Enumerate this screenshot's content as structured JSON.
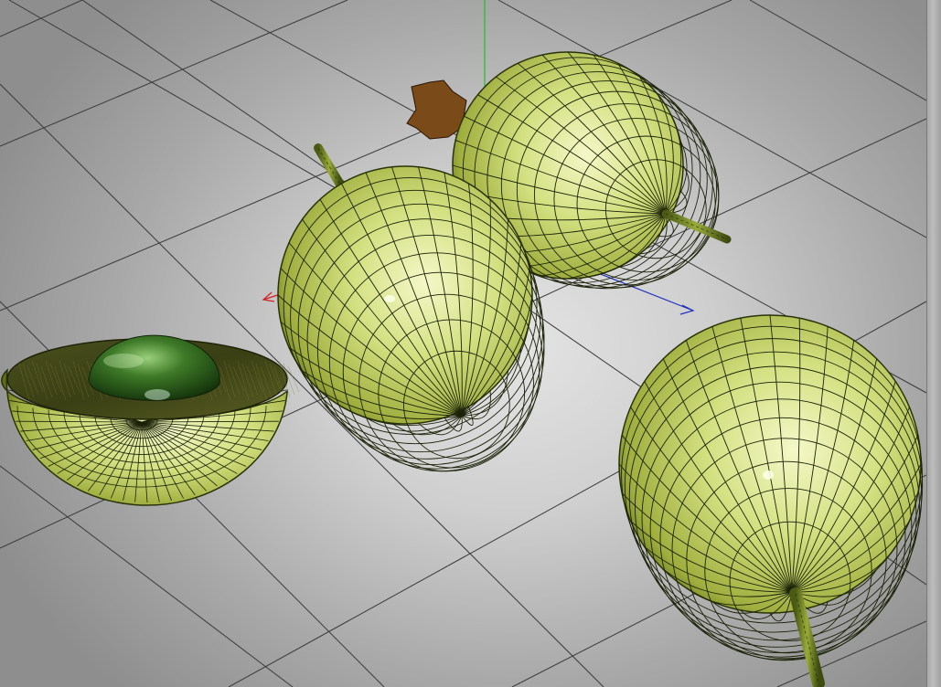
{
  "viewport": {
    "objects": [
      {
        "name": "fruit-half-cut"
      },
      {
        "name": "fruit-whole-center"
      },
      {
        "name": "fruit-whole-back"
      },
      {
        "name": "fruit-whole-front-right"
      }
    ],
    "axes": [
      "x-axis-red",
      "y-axis-green",
      "z-axis-blue"
    ],
    "colors": {
      "grid": "#3a3a3a",
      "fruit_light": "#eef4b4",
      "fruit_mid": "#c9d873",
      "fruit_dark": "#6f7d22",
      "wire": "#1b2208",
      "pit": "#2f5a1c",
      "leaf": "#7a4a18",
      "axis_x": "#d02020",
      "axis_y": "#20c020",
      "axis_z": "#2030c0"
    }
  }
}
